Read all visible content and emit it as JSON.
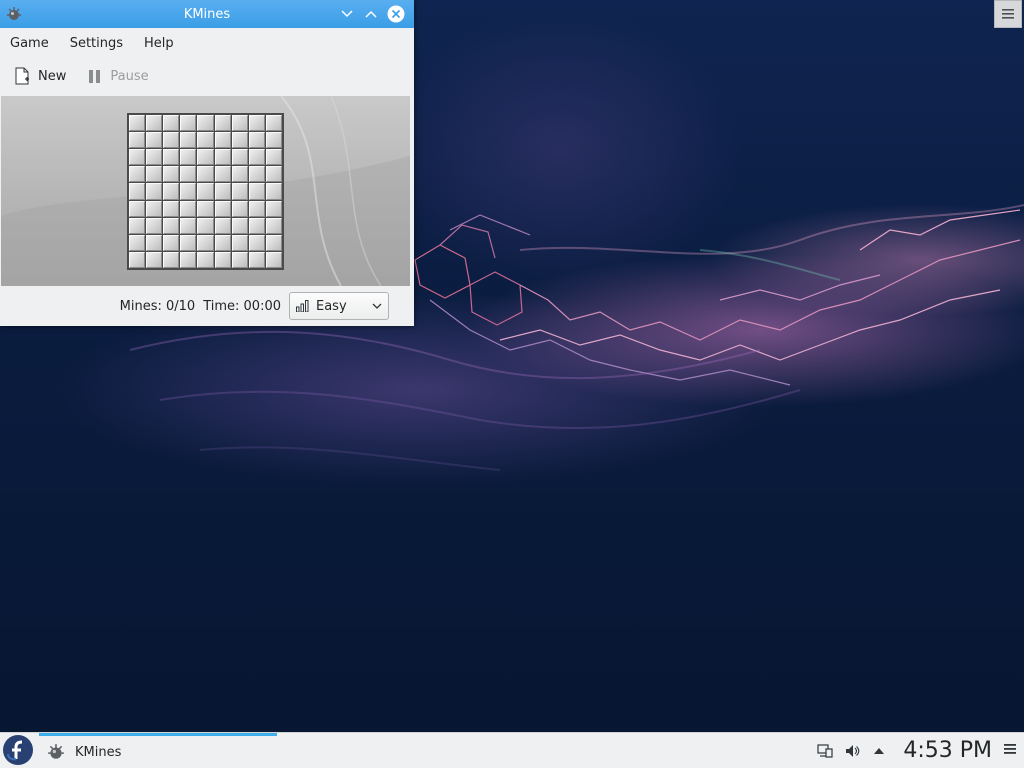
{
  "window": {
    "title": "KMines",
    "menu": [
      "Game",
      "Settings",
      "Help"
    ],
    "toolbar": {
      "new_label": "New",
      "pause_label": "Pause"
    }
  },
  "board": {
    "rows": 9,
    "cols": 9
  },
  "status": {
    "mines": "Mines: 0/10",
    "time": "Time: 00:00",
    "difficulty": "Easy"
  },
  "taskbar": {
    "task_label": "KMines",
    "clock": "4:53 PM"
  },
  "colors": {
    "accent": "#3daee9",
    "titlebar": "#3a9ee6",
    "panel": "#eff0f1"
  },
  "icons": [
    "kmines-icon",
    "chevron-down-icon",
    "chevron-up-icon",
    "close-icon",
    "new-document-icon",
    "pause-icon",
    "difficulty-bars-icon",
    "fedora-icon",
    "network-icon",
    "volume-icon",
    "tray-expand-icon",
    "hamburger-icon"
  ]
}
